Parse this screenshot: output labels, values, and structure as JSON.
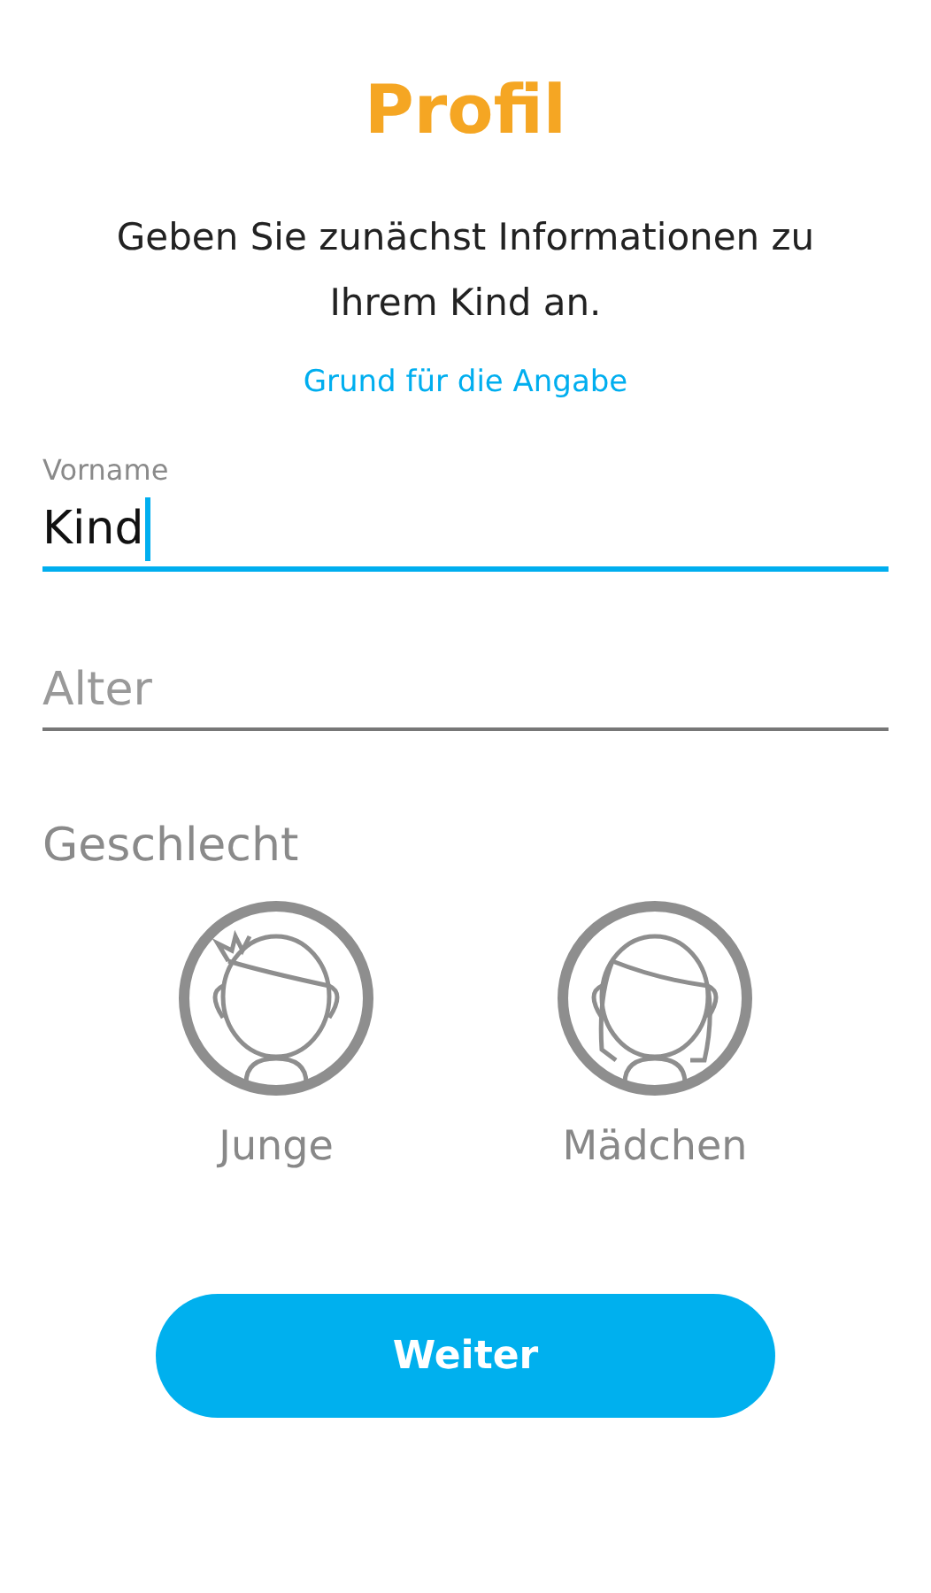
{
  "title": "Profil",
  "intro": "Geben Sie zunächst Informationen zu Ihrem Kind an.",
  "info_link": "Grund für die Angabe",
  "fields": [
    {
      "label": "Vorname",
      "value": "Kind",
      "focused": true
    },
    {
      "placeholder": "Alter",
      "focused": false
    }
  ],
  "gender": {
    "label": "Geschlecht",
    "options": [
      {
        "kind": "boy",
        "label": "Junge",
        "selected": false
      },
      {
        "kind": "girl",
        "label": "Mädchen",
        "selected": false
      }
    ]
  },
  "button": "Weiter"
}
